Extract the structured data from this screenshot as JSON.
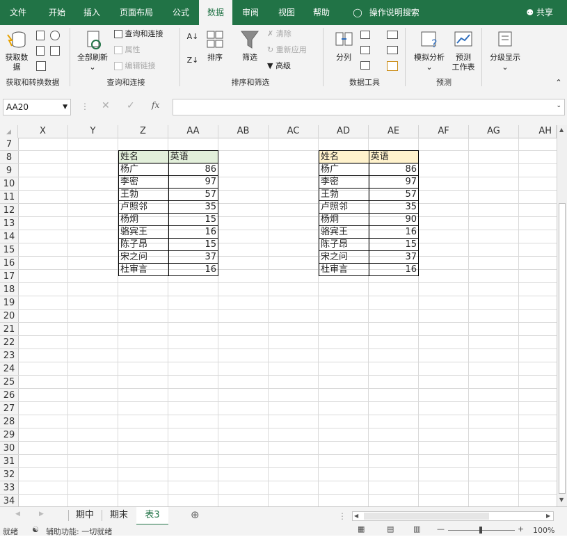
{
  "menu": {
    "items": [
      "文件",
      "开始",
      "插入",
      "页面布局",
      "公式",
      "数据",
      "审阅",
      "视图",
      "帮助",
      "操作说明搜索"
    ],
    "active": "数据",
    "share": "共享"
  },
  "ribbon": {
    "get_data_label": "获取数",
    "get_data_label2": "据",
    "refresh_all": "全部刷新",
    "queries_connections": "查询和连接",
    "properties": "属性",
    "edit_links": "编辑链接",
    "sort": "排序",
    "filter": "筛选",
    "clear": "清除",
    "reapply": "重新应用",
    "advanced": "高级",
    "text_to_columns": "分列",
    "what_if": "模拟分析",
    "forecast": "预测",
    "forecast2": "工作表",
    "outline": "分级显示",
    "groups": [
      "获取和转换数据",
      "查询和连接",
      "排序和筛选",
      "数据工具",
      "预测"
    ]
  },
  "formula_bar": {
    "name_box": "AA20",
    "formula": "",
    "fx": "fx"
  },
  "columns": [
    "X",
    "Y",
    "Z",
    "AA",
    "AB",
    "AC",
    "AD",
    "AE",
    "AF",
    "AG",
    "AH"
  ],
  "rows": [
    "7",
    "8",
    "9",
    "10",
    "11",
    "12",
    "13",
    "14",
    "15",
    "16",
    "17",
    "18",
    "19",
    "20",
    "21",
    "22",
    "23",
    "24",
    "25",
    "26",
    "27",
    "28",
    "29",
    "30",
    "31",
    "32",
    "33",
    "34"
  ],
  "table_left": {
    "headers": [
      "姓名",
      "英语"
    ],
    "header_color": "#e2efda",
    "rows": [
      [
        "杨广",
        "86"
      ],
      [
        "李密",
        "97"
      ],
      [
        "王勃",
        "57"
      ],
      [
        "卢照邻",
        "35"
      ],
      [
        "杨炯",
        "15"
      ],
      [
        "骆宾王",
        "16"
      ],
      [
        "陈子昂",
        "15"
      ],
      [
        "宋之问",
        "37"
      ],
      [
        "杜审言",
        "16"
      ]
    ]
  },
  "table_right": {
    "headers": [
      "姓名",
      "英语"
    ],
    "header_color": "#fff2cc",
    "rows": [
      [
        "杨广",
        "86"
      ],
      [
        "李密",
        "97"
      ],
      [
        "王勃",
        "57"
      ],
      [
        "卢照邻",
        "35"
      ],
      [
        "杨炯",
        "90"
      ],
      [
        "骆宾王",
        "16"
      ],
      [
        "陈子昂",
        "15"
      ],
      [
        "宋之问",
        "37"
      ],
      [
        "杜审言",
        "16"
      ]
    ]
  },
  "sheets": [
    "期中",
    "期末",
    "表3"
  ],
  "active_sheet": "表3",
  "status": {
    "ready": "就绪",
    "accessibility": "辅助功能: 一切就绪",
    "zoom": "100%"
  },
  "colors": {
    "brand": "#217346"
  }
}
